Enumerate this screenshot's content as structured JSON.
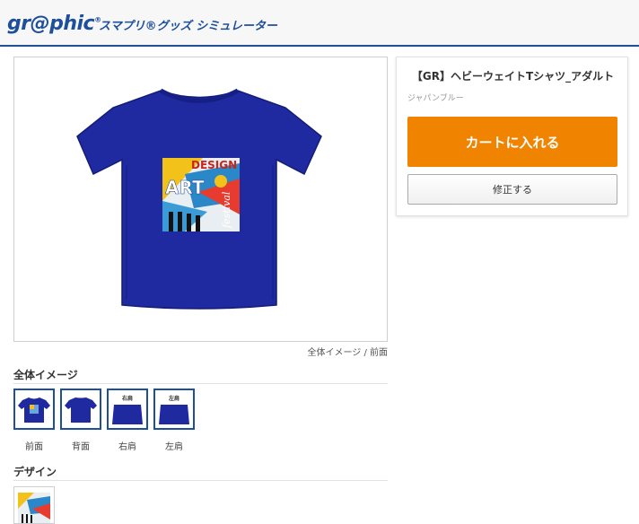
{
  "header": {
    "logo_text": "gr@phic",
    "logo_mark": "®",
    "subtitle": "スマプリ®グッズ シミュレーター"
  },
  "preview": {
    "print_texts": [
      "DESIGN",
      "ART",
      "festival"
    ],
    "caption": "全体イメージ / 前面"
  },
  "overall_image": {
    "title": "全体イメージ",
    "thumbs": [
      {
        "label": "前面",
        "tag": ""
      },
      {
        "label": "背面",
        "tag": ""
      },
      {
        "label": "右肩",
        "tag": "右肩"
      },
      {
        "label": "左肩",
        "tag": "左肩"
      }
    ]
  },
  "design": {
    "title": "デザイン"
  },
  "product": {
    "title": "【GR】ヘビーウェイトTシャツ_アダルト",
    "color": "ジャパンブルー",
    "cart_label": "カートに入れる",
    "edit_label": "修正する"
  },
  "colors": {
    "brand": "#1e4f9c",
    "cart": "#f08300",
    "shirt": "#1f2aa0"
  }
}
